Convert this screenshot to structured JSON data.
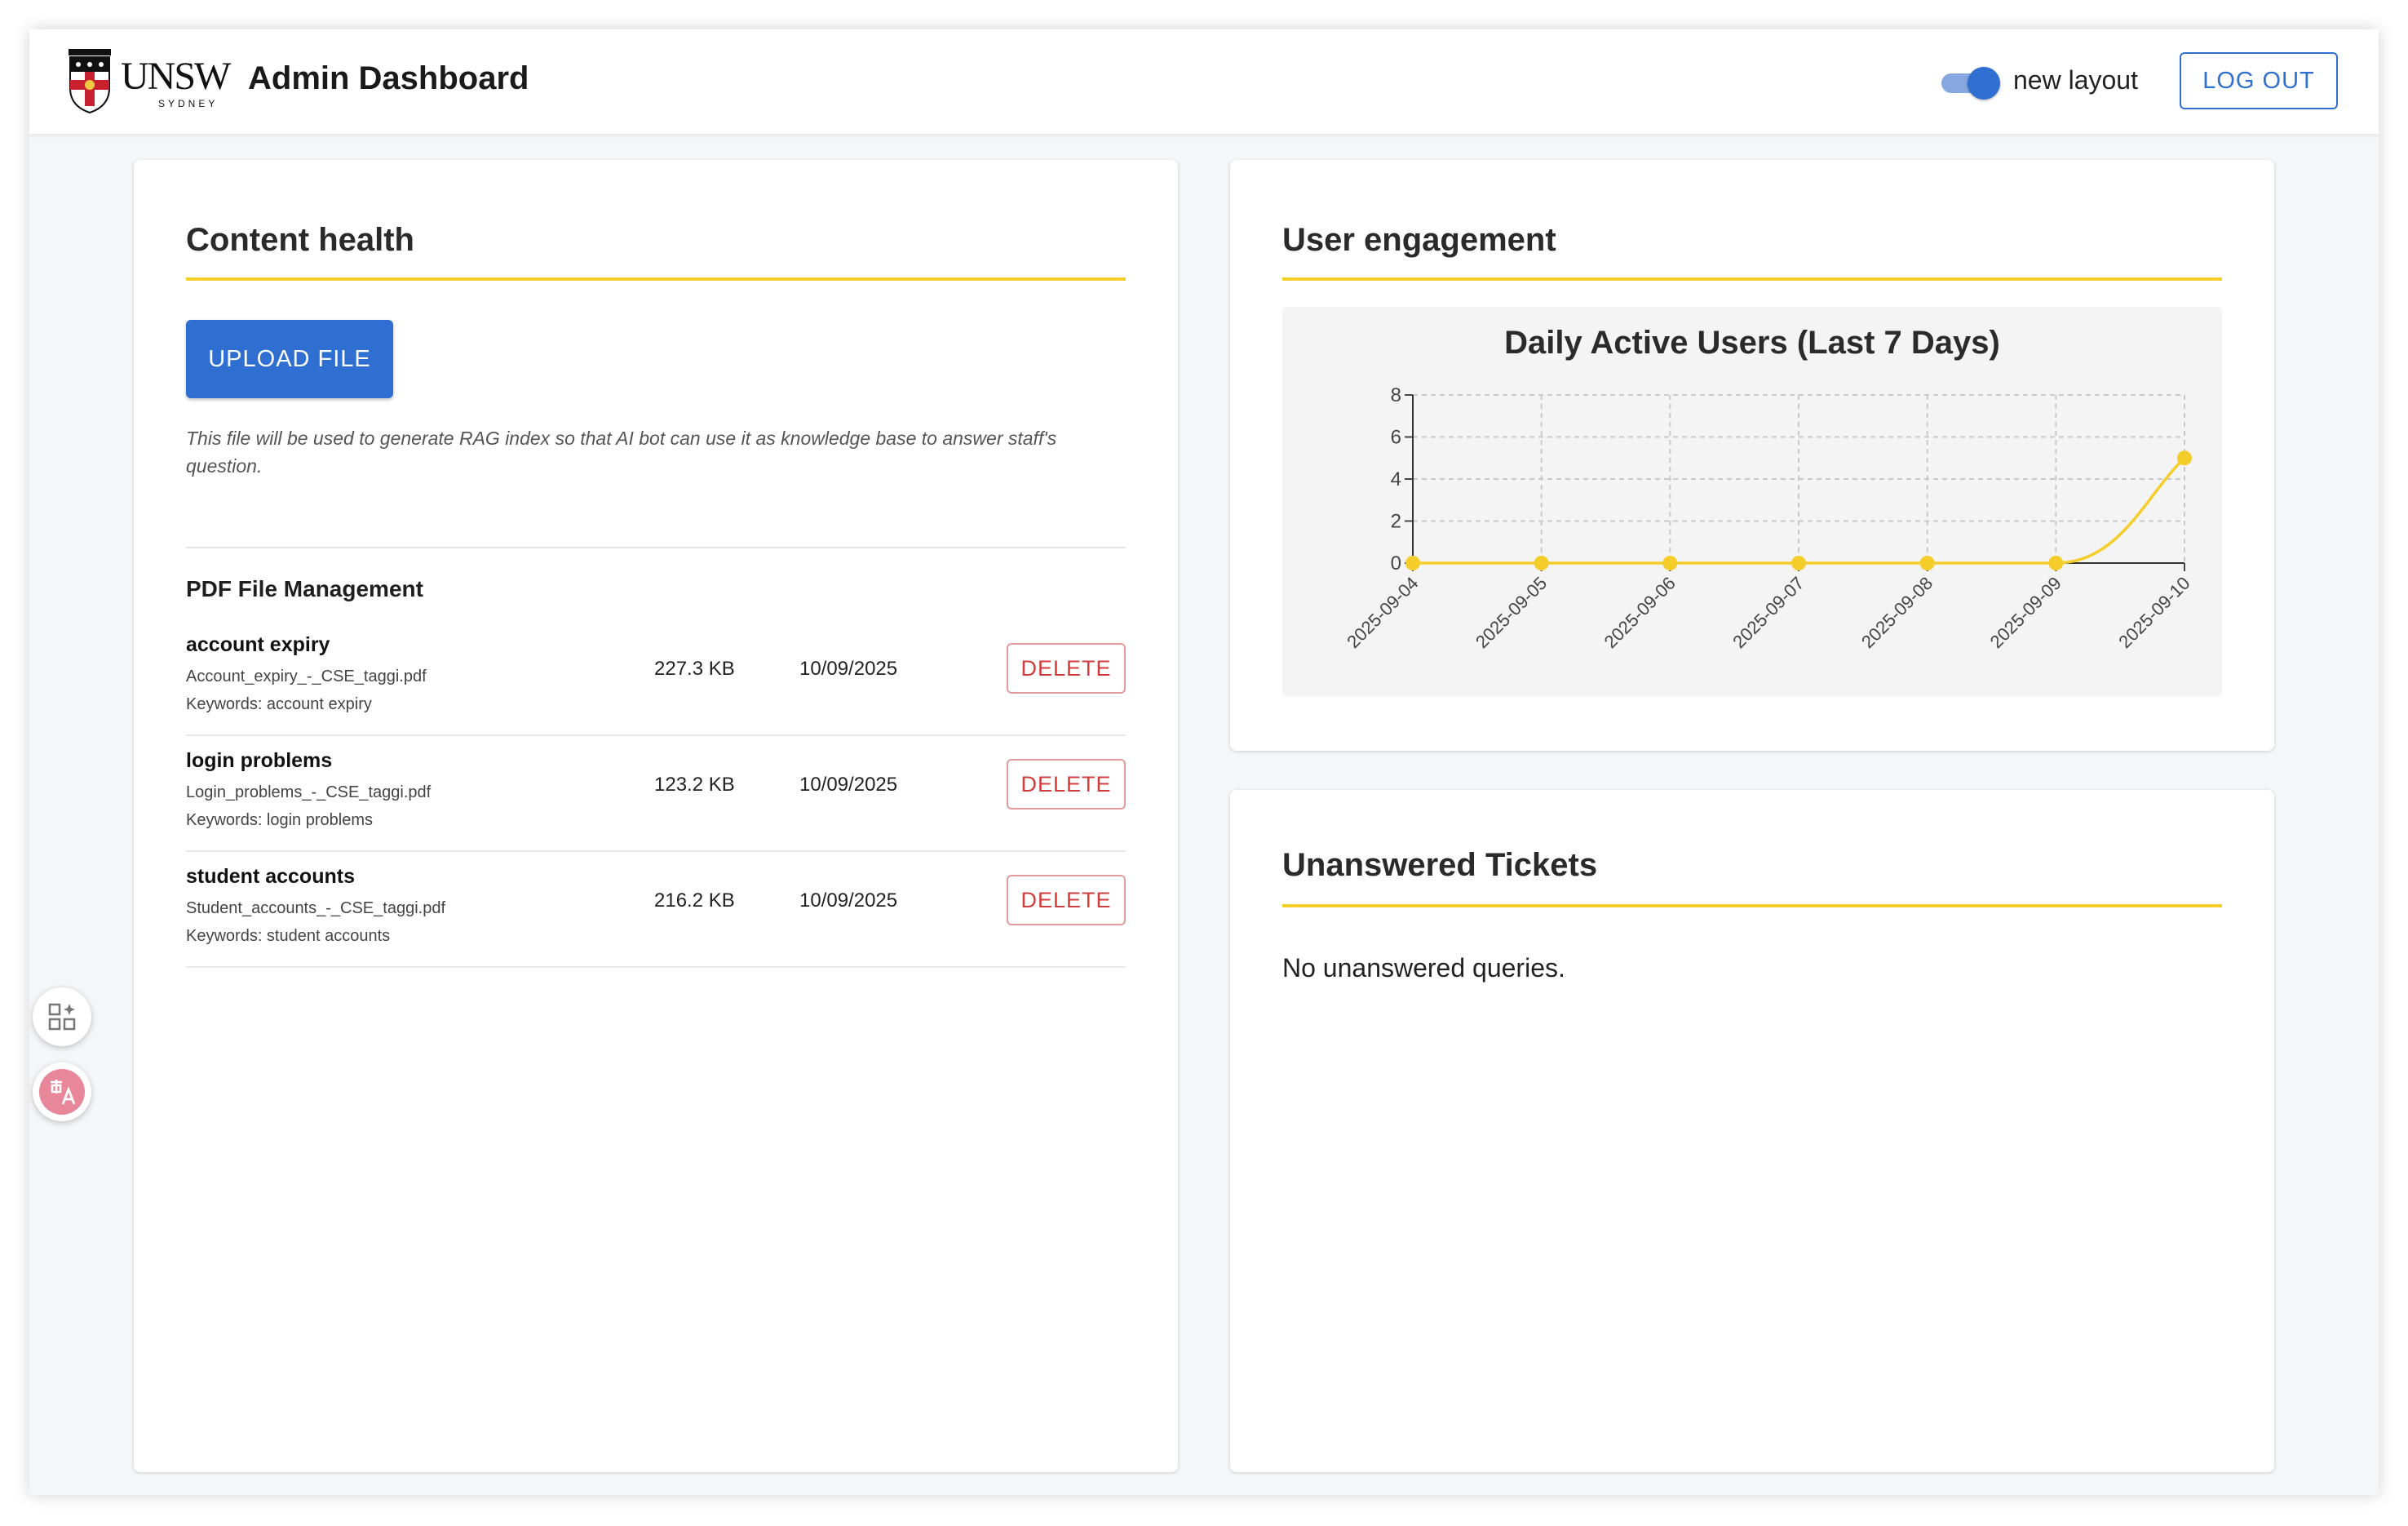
{
  "header": {
    "logo_text": "UNSW",
    "logo_subtext": "SYDNEY",
    "title": "Admin Dashboard",
    "toggle_label": "new layout",
    "toggle_on": true,
    "logout_label": "LOG OUT"
  },
  "content_health": {
    "title": "Content health",
    "upload_label": "UPLOAD FILE",
    "upload_note": "This file will be used to generate RAG index so that AI bot can use it as knowledge base to answer staff's question.",
    "section_title": "PDF File Management",
    "files": [
      {
        "name": "account expiry",
        "filename": "Account_expiry_-_CSE_taggi.pdf",
        "keywords": "Keywords: account expiry",
        "size": "227.3 KB",
        "date": "10/09/2025",
        "action": "DELETE"
      },
      {
        "name": "login problems",
        "filename": "Login_problems_-_CSE_taggi.pdf",
        "keywords": "Keywords: login problems",
        "size": "123.2 KB",
        "date": "10/09/2025",
        "action": "DELETE"
      },
      {
        "name": "student accounts",
        "filename": "Student_accounts_-_CSE_taggi.pdf",
        "keywords": "Keywords: student accounts",
        "size": "216.2 KB",
        "date": "10/09/2025",
        "action": "DELETE"
      }
    ]
  },
  "user_engagement": {
    "title": "User engagement"
  },
  "chart_data": {
    "type": "line",
    "title": "Daily Active Users (Last 7 Days)",
    "xlabel": "",
    "ylabel": "",
    "categories": [
      "2025-09-04",
      "2025-09-05",
      "2025-09-06",
      "2025-09-07",
      "2025-09-08",
      "2025-09-09",
      "2025-09-10"
    ],
    "series": [
      {
        "values": [
          0,
          0,
          0,
          0,
          0,
          0,
          5
        ]
      }
    ],
    "ylim": [
      0,
      8
    ],
    "yticks": [
      0,
      2,
      4,
      6,
      8
    ],
    "grid": true,
    "color": "#f5cd2b"
  },
  "tickets": {
    "title": "Unanswered Tickets",
    "empty_message": "No unanswered queries."
  },
  "colors": {
    "primary": "#2f6fd1",
    "accent": "#f5cd2b",
    "danger": "#d23c3c"
  },
  "side_tools": [
    {
      "icon": "apps-sparkle-icon"
    },
    {
      "icon": "translate-icon"
    }
  ]
}
